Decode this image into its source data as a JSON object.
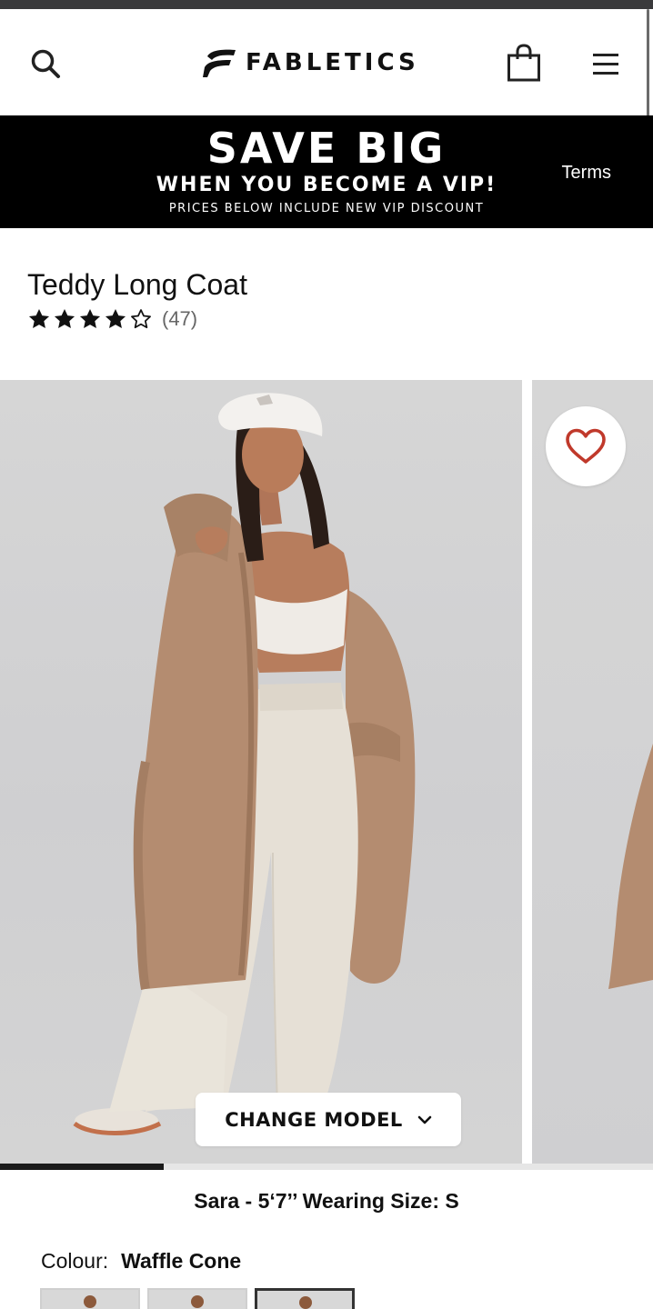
{
  "header": {
    "brand": "FABLETICS",
    "icons": {
      "search": "search-icon",
      "bag": "shopping-bag-icon",
      "menu": "hamburger-menu-icon"
    }
  },
  "promo": {
    "headline": "SAVE BIG",
    "subheadline": "WHEN YOU BECOME A VIP!",
    "note": "PRICES BELOW INCLUDE NEW VIP DISCOUNT",
    "terms_label": "Terms"
  },
  "product": {
    "title": "Teddy Long Coat",
    "rating": 4.5,
    "rating_max": 5,
    "review_count": "(47)"
  },
  "gallery": {
    "change_model_label": "CHANGE MODEL",
    "progress": 0.25,
    "favorite_icon": "heart-icon",
    "chevron_icon": "chevron-down-icon"
  },
  "model_info": "Sara - 5‘7’’ Wearing Size: S",
  "colour": {
    "label": "Colour:",
    "value": "Waffle Cone",
    "swatch_count": 3,
    "selected_index": 2
  },
  "colors": {
    "promo_bg": "#000000",
    "heart": "#c0392b",
    "text": "#111111",
    "coat": "#b48c70"
  }
}
